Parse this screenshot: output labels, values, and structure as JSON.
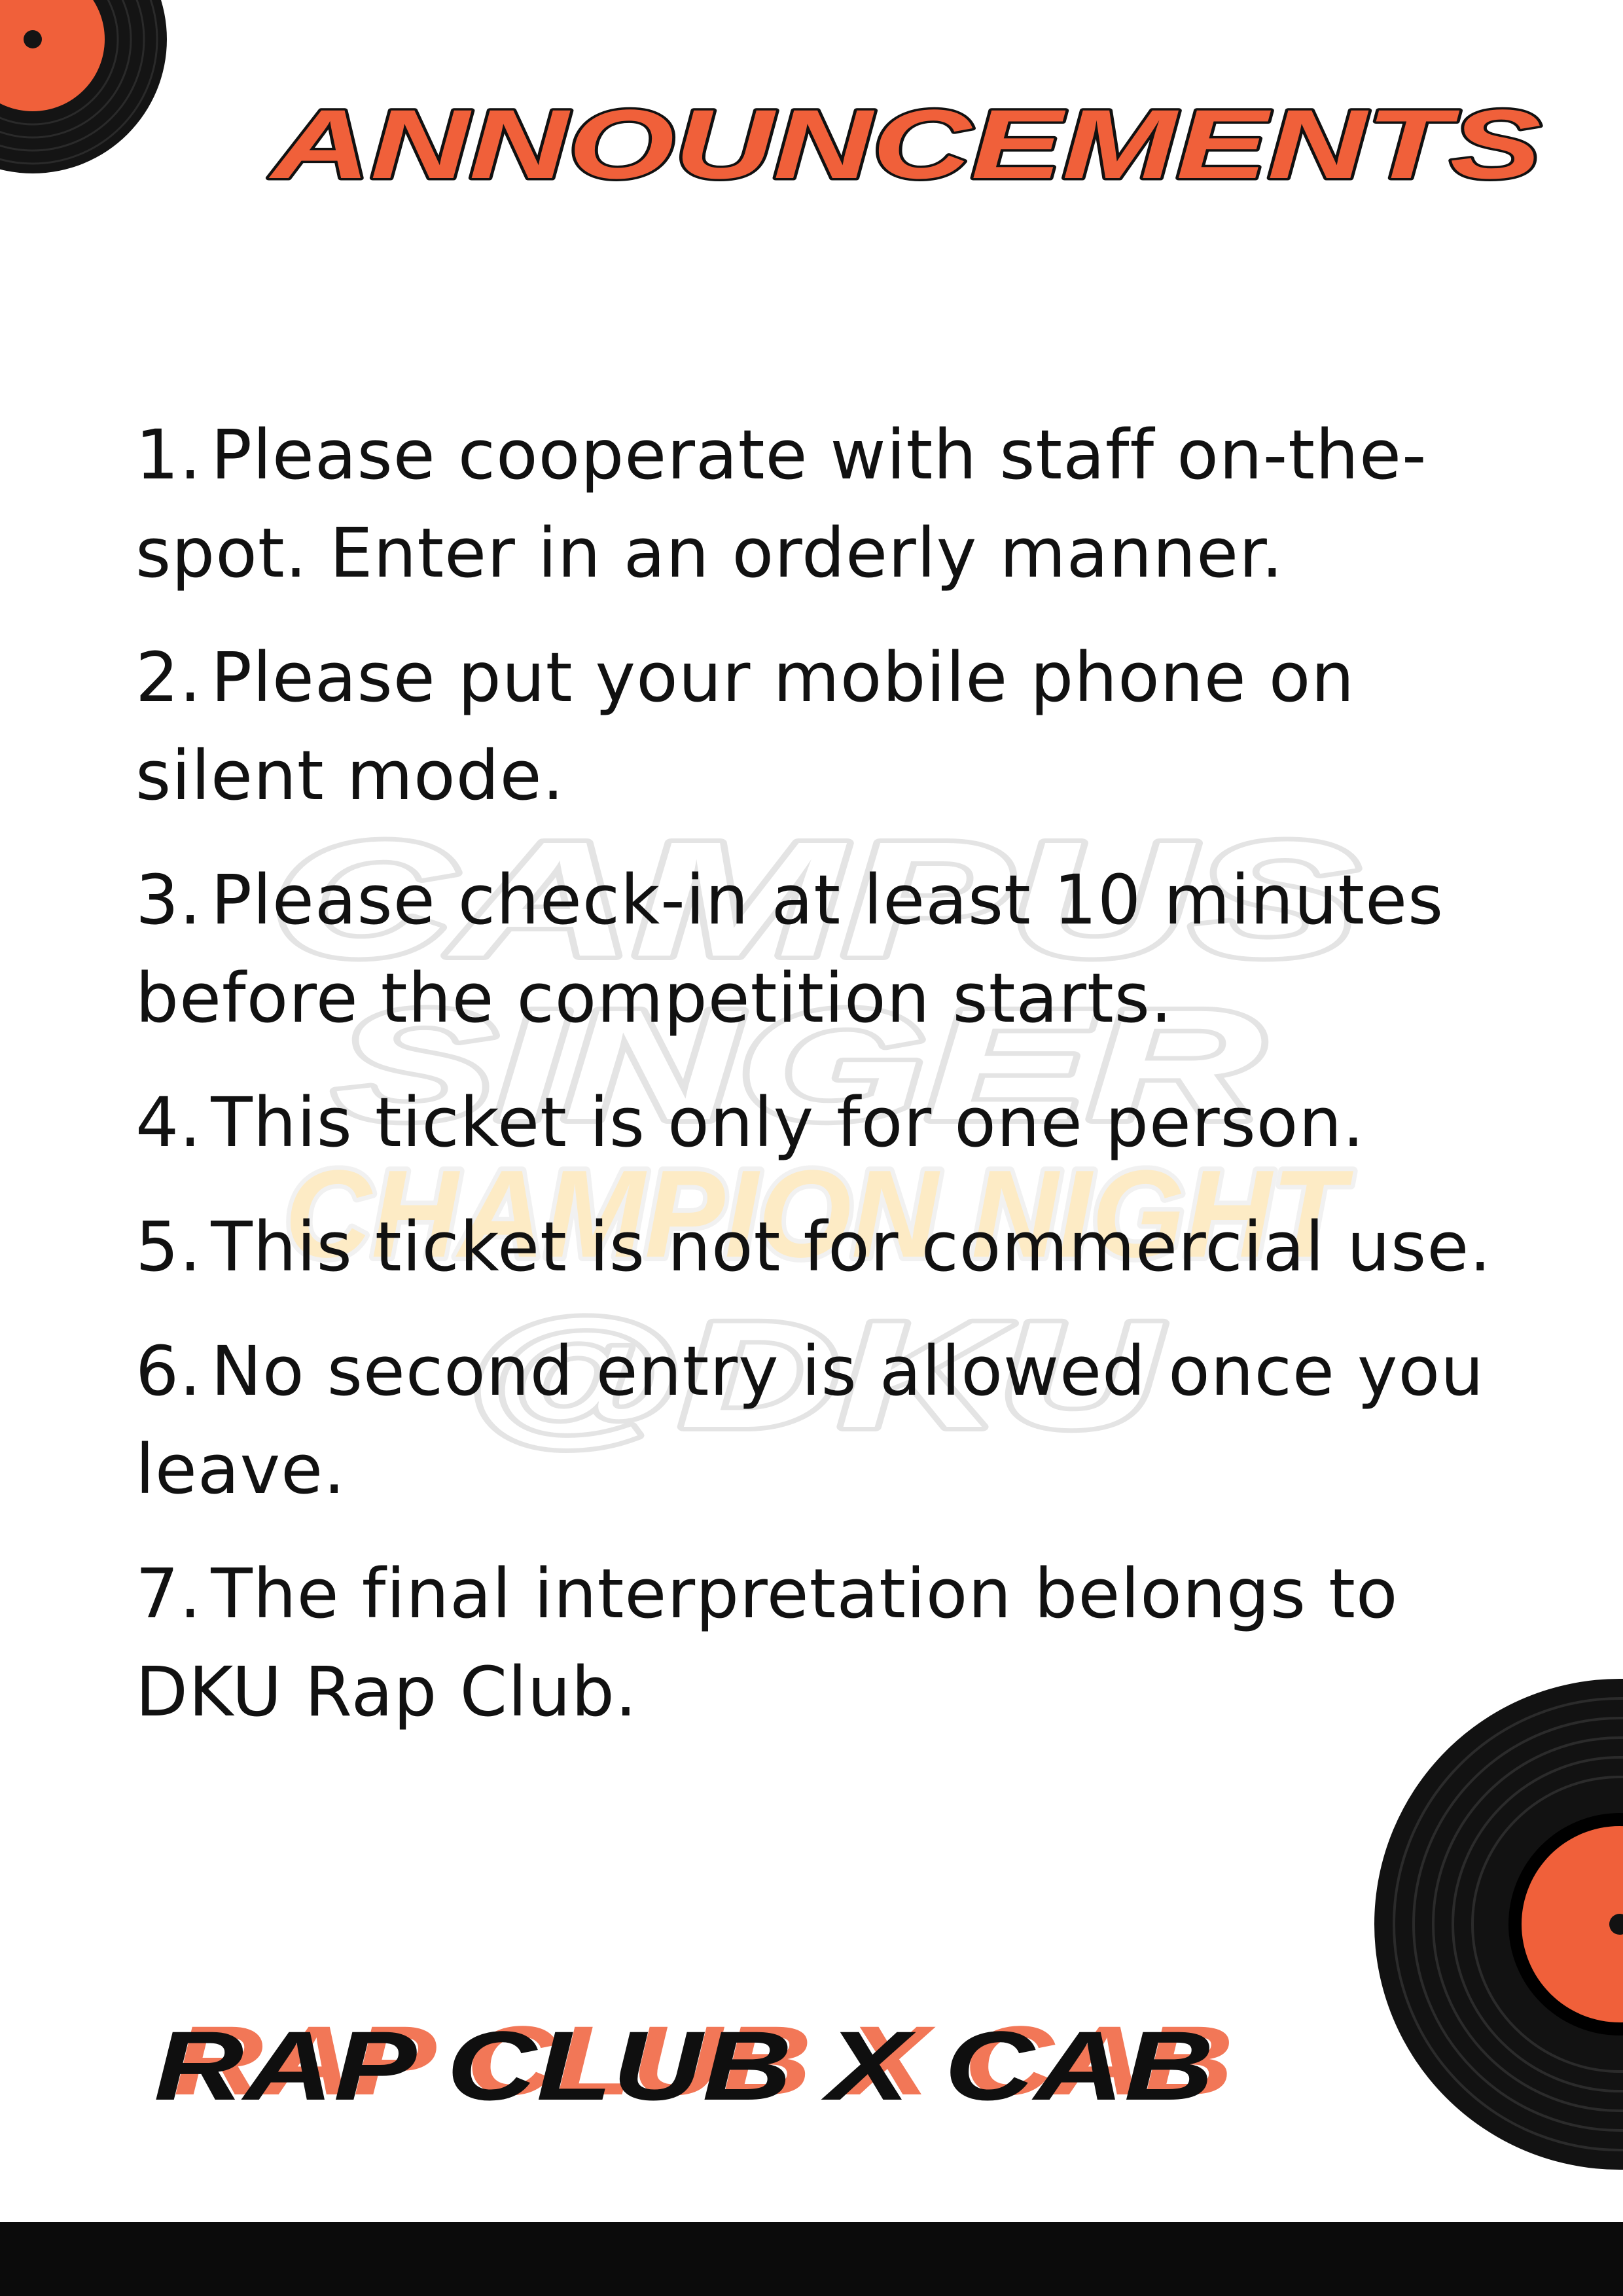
{
  "title": "ANNOUNCEMENTS",
  "watermark": {
    "line1": "CAMPUS",
    "line2": "SINGER",
    "line3": "CHAMPION NIGHT",
    "line4": "@DKU"
  },
  "announcements": [
    {
      "number": "1.",
      "text": "Please cooperate with staff on-the-spot. Enter in an orderly manner."
    },
    {
      "number": "2.",
      "text": "Please put your mobile phone on silent mode."
    },
    {
      "number": "3.",
      "text": "Please check-in at least 10 minutes before the competition starts."
    },
    {
      "number": "4.",
      "text": "This ticket is only for one person."
    },
    {
      "number": "5.",
      "text": "This ticket is not for commercial use."
    },
    {
      "number": "6.",
      "text": "No second entry is allowed once you leave."
    },
    {
      "number": "7.",
      "text": "The final interpretation belongs to DKU Rap Club."
    }
  ],
  "credit": "RAP CLUB X CAB",
  "colors": {
    "accent": "#F0603A",
    "text": "#111111",
    "record": "#121212",
    "watermark_gray": "#e6e6e6",
    "watermark_yellow": "#fde9bf"
  },
  "icons": [
    "vinyl-record-icon"
  ]
}
